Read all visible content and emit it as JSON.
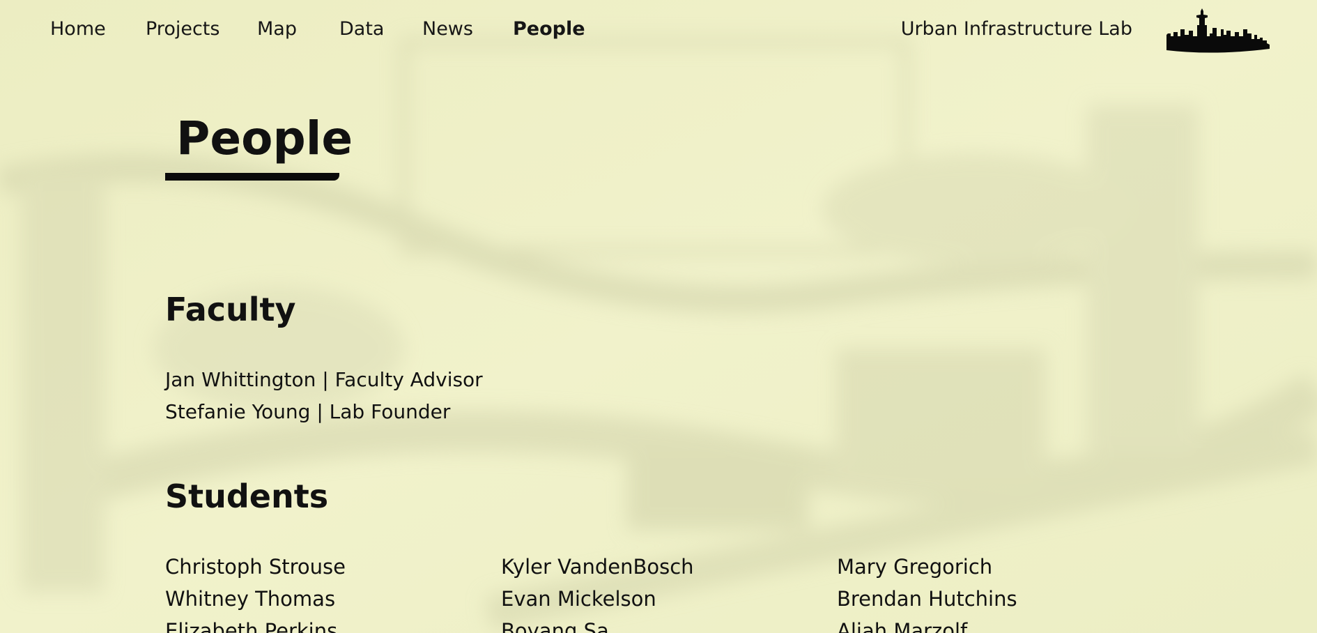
{
  "nav": {
    "items": [
      {
        "label": "Home",
        "active": false
      },
      {
        "label": "Projects",
        "active": false
      },
      {
        "label": "Map",
        "active": false
      },
      {
        "label": "Data",
        "active": false
      },
      {
        "label": "News",
        "active": false
      },
      {
        "label": "People",
        "active": true
      }
    ],
    "lab_name": "Urban Infrastructure Lab",
    "logo_icon": "city-skyline-icon"
  },
  "page": {
    "title": "People"
  },
  "faculty": {
    "heading": "Faculty",
    "members": [
      "Jan Whittington | Faculty Advisor",
      "Stefanie Young | Lab Founder"
    ]
  },
  "students": {
    "heading": "Students",
    "columns": [
      [
        "Christoph Strouse",
        "Whitney Thomas",
        "Elizabeth Perkins"
      ],
      [
        "Kyler VandenBosch",
        "Evan Mickelson",
        "Boyang Sa"
      ],
      [
        "Mary Gregorich",
        "Brendan Hutchins",
        "Aliah Marzolf"
      ]
    ]
  },
  "colors": {
    "background": "#eff0c6",
    "text": "#111111",
    "accent": "#0a0a0a"
  }
}
